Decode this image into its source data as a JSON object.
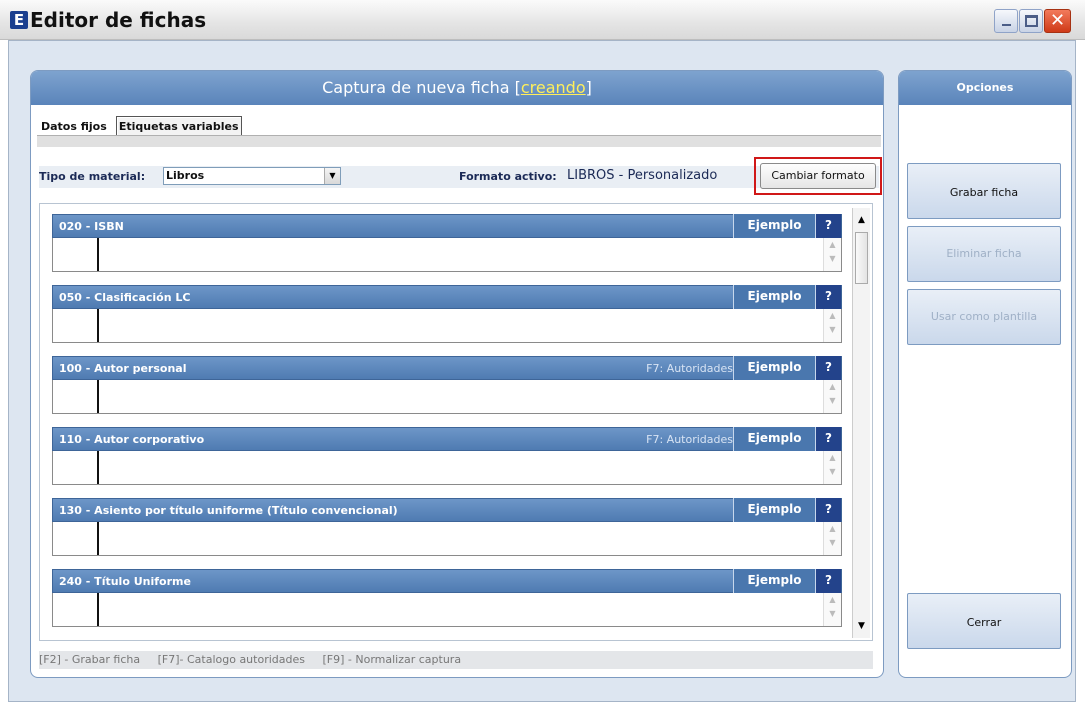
{
  "window": {
    "title": "Editor de fichas",
    "app_icon": "E"
  },
  "main": {
    "header_prefix": "Captura de nueva ficha [",
    "header_state": "creando",
    "header_suffix": "]",
    "tabs": [
      {
        "label": "Datos fijos"
      },
      {
        "label": "Etiquetas variables"
      }
    ],
    "material_label": "Tipo de material:",
    "material_value": "Libros",
    "format_label": "Formato activo:",
    "format_value": "LIBROS - Personalizado",
    "change_format_button": "Cambiar formato",
    "fields": [
      {
        "label": "020 - ISBN",
        "f7": "",
        "example": "Ejemplo",
        "help": "?"
      },
      {
        "label": "050 - Clasificación LC",
        "f7": "",
        "example": "Ejemplo",
        "help": "?"
      },
      {
        "label": "100 - Autor personal",
        "f7": "F7: Autoridades",
        "example": "Ejemplo",
        "help": "?"
      },
      {
        "label": "110 - Autor corporativo",
        "f7": "F7: Autoridades",
        "example": "Ejemplo",
        "help": "?"
      },
      {
        "label": "130 - Asiento por título uniforme (Título convencional)",
        "f7": "",
        "example": "Ejemplo",
        "help": "?"
      },
      {
        "label": "240 - Título Uniforme",
        "f7": "",
        "example": "Ejemplo",
        "help": "?"
      }
    ],
    "hotkeys": [
      "[F2] - Grabar ficha",
      "[F7]- Catalogo autoridades",
      "[F9] - Normalizar captura"
    ]
  },
  "options": {
    "header": "Opciones",
    "save_button": "Grabar ficha",
    "delete_button": "Eliminar ficha",
    "template_button": "Usar como plantilla",
    "close_button": "Cerrar"
  }
}
